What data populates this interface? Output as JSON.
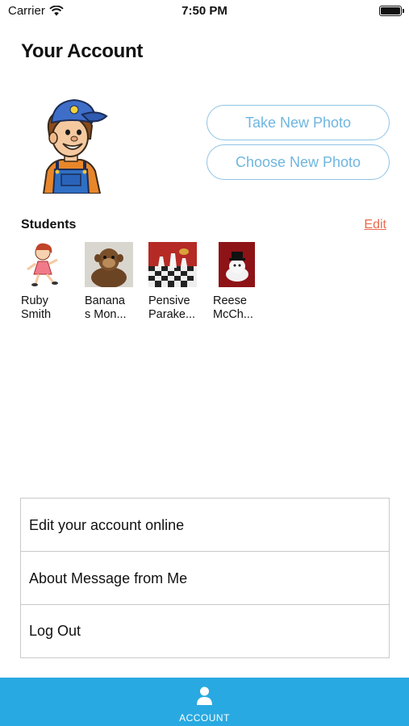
{
  "status_bar": {
    "carrier": "Carrier",
    "time": "7:50 PM"
  },
  "header": {
    "title": "Your Account"
  },
  "photo_actions": {
    "take_label": "Take New Photo",
    "choose_label": "Choose New Photo"
  },
  "students": {
    "title": "Students",
    "edit_label": "Edit",
    "items": [
      {
        "name": "Ruby\nSmith"
      },
      {
        "name": "Banana\ns Mon..."
      },
      {
        "name": "Pensive\nParake..."
      },
      {
        "name": "Reese\nMcCh..."
      }
    ]
  },
  "menu": {
    "items": [
      {
        "label": "Edit your account online"
      },
      {
        "label": "About Message from Me"
      },
      {
        "label": "Log Out"
      }
    ]
  },
  "tab_bar": {
    "account_label": "ACCOUNT"
  },
  "colors": {
    "accent": "#29a9e1",
    "button_text": "#6fb6e0",
    "edit_link": "#e9694f"
  }
}
